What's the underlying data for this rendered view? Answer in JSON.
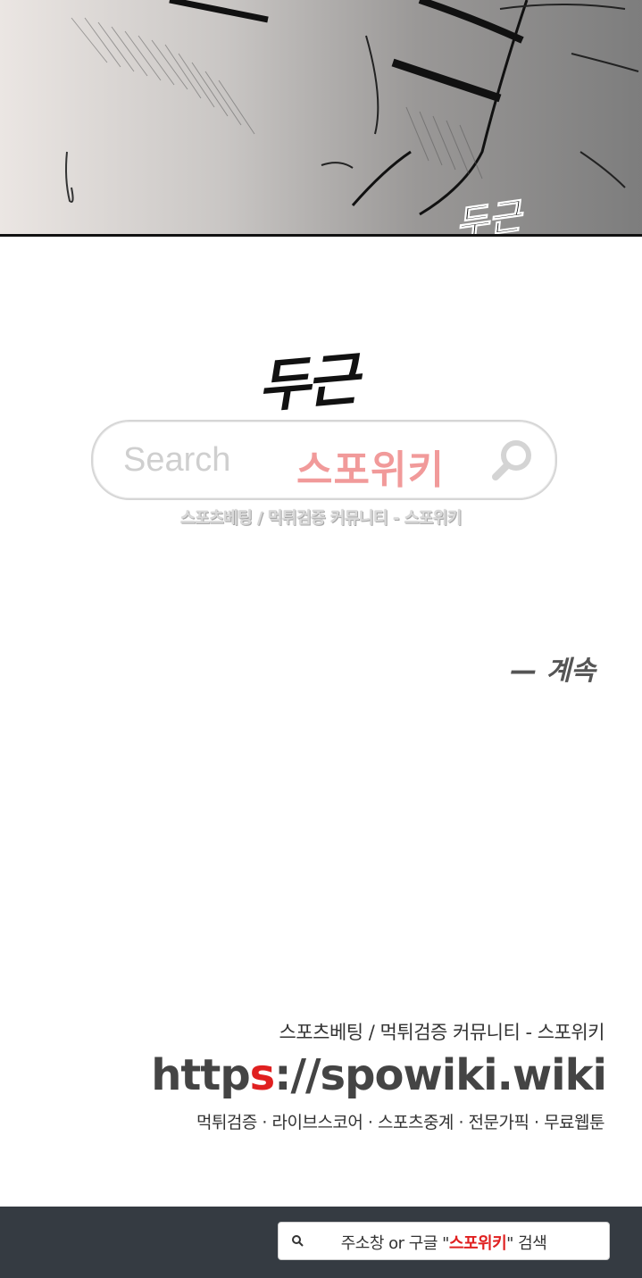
{
  "panel": {
    "sfx": "두근"
  },
  "page": {
    "sfx_large": "두근",
    "continued": "— 계속"
  },
  "watermark": {
    "search_placeholder": "Search",
    "search_brand": "스포위키",
    "caption": "스포츠베팅 / 먹튀검증 커뮤니티 - 스포위키"
  },
  "promo": {
    "line1": "스포츠베팅 / 먹튀검증 커뮤니티 - 스포위키",
    "url_pre": "http",
    "url_hl": "s",
    "url_post": "://spowiki.wiki",
    "line3": "먹튀검증 · 라이브스코어 · 스포츠중계 · 전문가픽 · 무료웹툰"
  },
  "bottom_bar": {
    "text_pre": "주소창 or 구글",
    "quote_open": " \"",
    "keyword": "스포위키",
    "quote_close": "\"",
    "text_post": " 검색",
    "icon": "search-icon"
  },
  "colors": {
    "brand_red": "#e02020",
    "bar_bg": "#353b42",
    "brand_pink": "#f19a9a"
  }
}
